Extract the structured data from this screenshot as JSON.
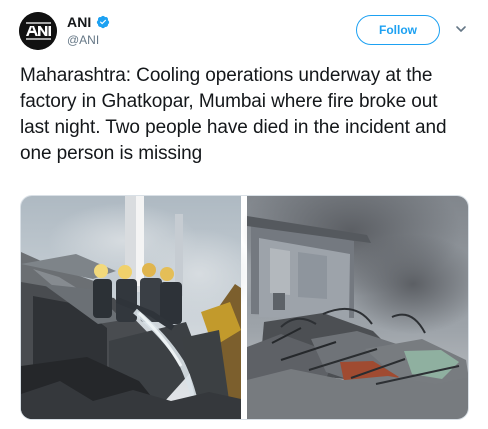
{
  "account": {
    "name": "ANI",
    "handle": "@ANI",
    "verified": true,
    "avatar": {
      "icon": "ani-logo-icon"
    }
  },
  "actions": {
    "follow_label": "Follow",
    "menu_icon": "chevron-down-icon"
  },
  "tweet": {
    "text": "Maharashtra: Cooling operations underway at the factory in Ghatkopar, Mumbai where fire broke out last night. Two people have died in the incident and one person is missing"
  },
  "media": {
    "kind": "photo-collage",
    "panels": 2,
    "description_icon": "photo-icon"
  },
  "colors": {
    "brand_blue": "#1da1f2",
    "text_primary": "#14171a",
    "text_secondary": "#657786",
    "border": "#d9e0e6"
  }
}
